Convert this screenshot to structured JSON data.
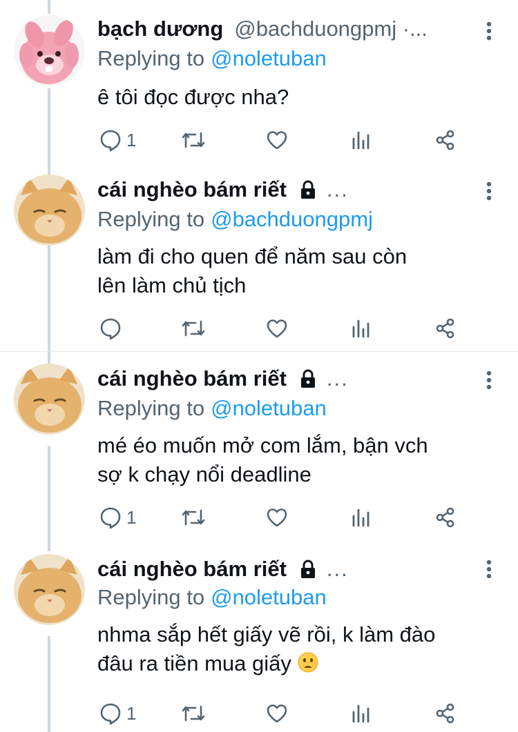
{
  "tweets": [
    {
      "name": "bạch dương",
      "handle": "@bachduongpmj ·...",
      "replying_label": "Replying to",
      "replying_to": "@noletuban",
      "text_lines": [
        "ê tôi đọc được nha?"
      ],
      "reply_count": "1",
      "avatar": "pink-cartoon-beaver-avatar",
      "locked": false
    },
    {
      "name": "cái nghèo bám riết",
      "handle": "...",
      "replying_label": "Replying to",
      "replying_to": "@bachduongpmj",
      "text_lines": [
        "làm đi cho quen để năm sau còn",
        "lên làm chủ tịch"
      ],
      "reply_count": "",
      "avatar": "orange-cat-avatar",
      "locked": true
    },
    {
      "name": "cái nghèo bám riết",
      "handle": "...",
      "replying_label": "Replying to",
      "replying_to": "@noletuban",
      "text_lines": [
        "mé éo muốn mở com lắm, bận vch",
        "sợ k chạy nổi deadline"
      ],
      "reply_count": "1",
      "avatar": "orange-cat-avatar",
      "locked": true
    },
    {
      "name": "cái nghèo bám riết",
      "handle": "...",
      "replying_label": "Replying to",
      "replying_to": "@noletuban",
      "text_lines": [
        "nhma sắp hết giấy vẽ rồi, k làm đào",
        "đâu ra tiền mua giấy"
      ],
      "reply_count": "1",
      "avatar": "orange-cat-avatar",
      "locked": true,
      "emoji": "frowning-face-emoji"
    }
  ],
  "colors": {
    "link": "#1d9bf0",
    "muted": "#536471",
    "text": "#0f1419",
    "thread_line": "#cfd9de"
  }
}
